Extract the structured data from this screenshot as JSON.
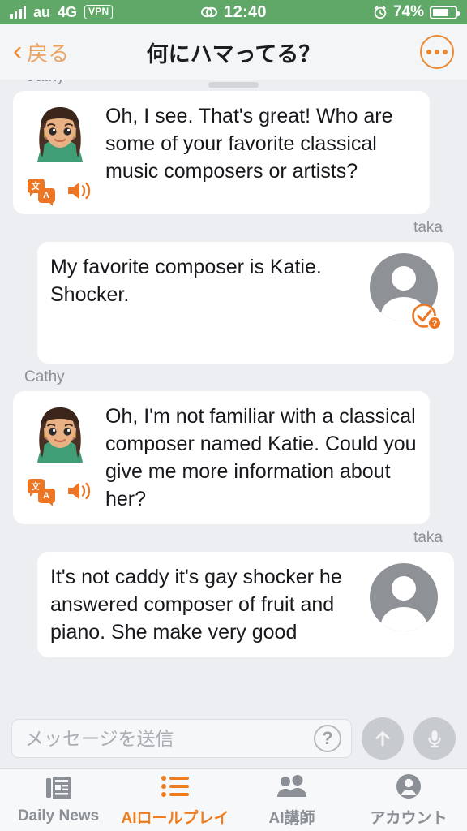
{
  "status_bar": {
    "signal_icon": "signal-bars-icon",
    "carrier": "au",
    "network": "4G",
    "vpn": "VPN",
    "link_icon": "link-icon",
    "time": "12:40",
    "alarm_icon": "alarm-clock-icon",
    "battery_percent": "74%",
    "battery_level": 74,
    "background_color": "#5fa868"
  },
  "header": {
    "back_label": "戻る",
    "back_icon": "chevron-left-icon",
    "title": "何にハマってる？",
    "more_icon": "more-options-icon"
  },
  "chat": {
    "messages": [
      {
        "sender": "Cathy",
        "side": "left",
        "text": "Oh, I see. That's great! Who are some of your favorite classical music composers or artists?",
        "avatar": "cathy-illustration-avatar",
        "translate_icon": "translate-icon",
        "speaker_icon": "speaker-icon"
      },
      {
        "sender": "taka",
        "side": "right",
        "text": "My favorite composer is Katie. Shocker.",
        "avatar": "user-person-avatar",
        "badge_icon": "check-question-badge-icon"
      },
      {
        "sender": "Cathy",
        "side": "left",
        "text": "Oh, I'm not familiar with a classical composer named Katie. Could you give me more information about her?",
        "avatar": "cathy-illustration-avatar",
        "translate_icon": "translate-icon",
        "speaker_icon": "speaker-icon"
      },
      {
        "sender": "taka",
        "side": "right",
        "text": "It's not caddy it's gay shocker he answered composer of fruit and piano. She make very good",
        "avatar": "user-person-avatar"
      }
    ]
  },
  "composer": {
    "placeholder": "メッセージを送信",
    "value": "",
    "help_icon": "question-mark-icon",
    "send_icon": "arrow-up-icon",
    "mic_icon": "microphone-icon"
  },
  "tabbar": {
    "items": [
      {
        "label": "Daily News",
        "icon": "newspaper-icon",
        "active": false
      },
      {
        "label": "AIロールプレイ",
        "icon": "list-icon",
        "active": true
      },
      {
        "label": "AI講師",
        "icon": "people-icon",
        "active": false
      },
      {
        "label": "アカウント",
        "icon": "account-circle-icon",
        "active": false
      }
    ],
    "active_color": "#ef7d1e",
    "inactive_color": "#8b9096"
  },
  "colors": {
    "accent_orange": "#ec7623",
    "status_green": "#5fa868",
    "chat_background": "#eceef1",
    "bubble_white": "#ffffff"
  }
}
